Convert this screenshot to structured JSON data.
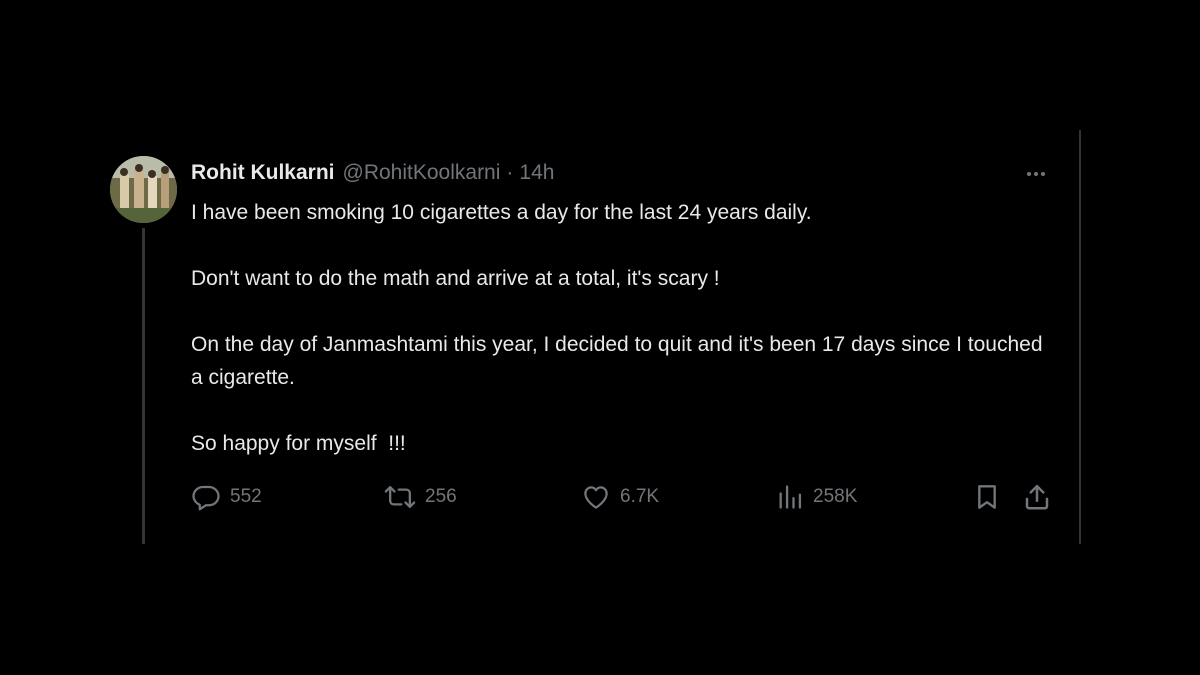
{
  "tweet": {
    "author": {
      "display_name": "Rohit Kulkarni",
      "handle": "@RohitKoolkarni",
      "separator": "·",
      "time": "14h"
    },
    "paragraphs": [
      "I have been smoking 10 cigarettes a day for the last 24 years daily.",
      "Don't want to do the math and arrive at a total, it's scary !",
      "On the day of Janmashtami this year, I decided to quit and it's been 17 days since I touched a cigarette.",
      "So happy for myself  !!!"
    ],
    "actions": {
      "replies": "552",
      "reposts": "256",
      "likes": "6.7K",
      "views": "258K"
    },
    "icons": {
      "reply": "reply-icon",
      "repost": "repost-icon",
      "like": "heart-icon",
      "views": "views-icon",
      "bookmark": "bookmark-icon",
      "share": "share-icon",
      "more": "more-icon"
    }
  },
  "colors": {
    "background": "#000000",
    "text_primary": "#e7e9ea",
    "text_secondary": "#71767b",
    "border": "#2f3336"
  }
}
